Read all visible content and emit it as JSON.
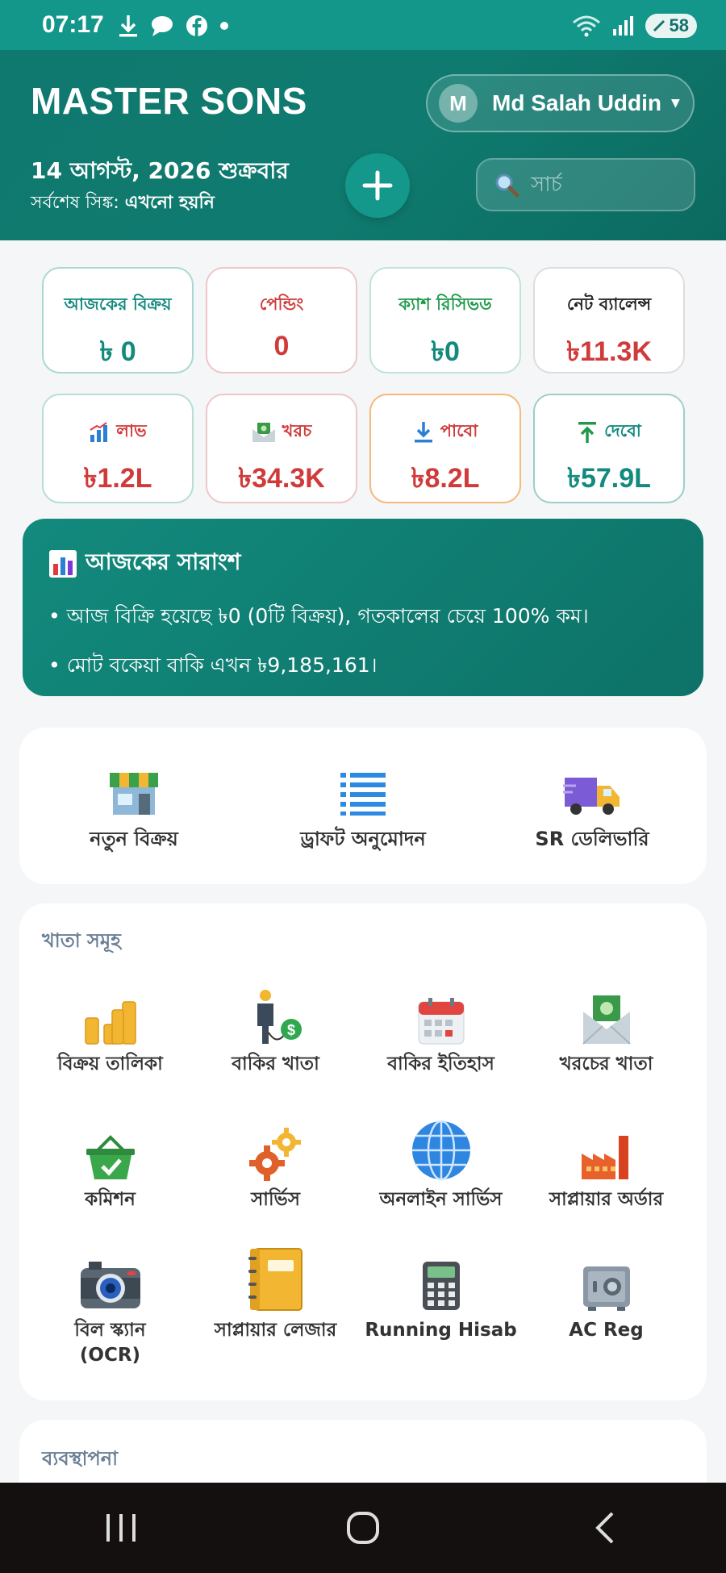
{
  "status_bar": {
    "time": "07:17",
    "battery": "58"
  },
  "header": {
    "brand": "MASTER SONS",
    "user_initial": "M",
    "user_name": "Md Salah Uddin",
    "date": "14 আগস্ট, 2026 শুক্রবার",
    "sync_label": "সর্বশেষ সিঙ্ক:",
    "sync_value": "এখনো হয়নি",
    "add_label": "+",
    "search_placeholder": "সার্চ"
  },
  "stats_row1": [
    {
      "label": "আজকের বিক্রয়",
      "value": "৳ 0",
      "label_color": "#128a7d",
      "value_color": "#128a7d",
      "border": "#a9d8d2"
    },
    {
      "label": "পেন্ডিং",
      "value": "0",
      "label_color": "#d13a3a",
      "value_color": "#d13a3a",
      "border": "#f0c6c6"
    },
    {
      "label": "ক্যাশ রিসিভড",
      "value": "৳0",
      "label_color": "#1f9a4a",
      "value_color": "#128a7d",
      "border": "#bfe4d6"
    },
    {
      "label": "নেট ব্যালেন্স",
      "value": "৳11.3K",
      "label_color": "#222222",
      "value_color": "#d13a3a",
      "border": "#dddddd"
    }
  ],
  "stats_row2": [
    {
      "label": "লাভ",
      "value": "৳1.2L",
      "label_color": "#d13a3a",
      "value_color": "#d13a3a",
      "border": "#b8dcd6",
      "icon": "bar-chart-icon"
    },
    {
      "label": "খরচ",
      "value": "৳34.3K",
      "label_color": "#d13a3a",
      "value_color": "#d13a3a",
      "border": "#f0c6c6",
      "icon": "money-envelope-icon"
    },
    {
      "label": "পাবো",
      "value": "৳8.2L",
      "label_color": "#d13a3a",
      "value_color": "#d13a3a",
      "border": "#f5b97a",
      "icon": "download-arrow-icon"
    },
    {
      "label": "দেবো",
      "value": "৳57.9L",
      "label_color": "#128a7d",
      "value_color": "#128a7d",
      "border": "#9ccfc7",
      "icon": "upload-arrow-icon"
    }
  ],
  "summary": {
    "title": "আজকের সারাংশ",
    "line1": "• আজ বিক্রি হয়েছে ৳0 (0টি বিক্রয়), গতকালের চেয়ে 100% কম।",
    "line2": "• মোট বকেয়া বাকি এখন ৳9,185,161।"
  },
  "quick_actions": [
    {
      "label": "নতুন বিক্রয়",
      "icon": "store-icon"
    },
    {
      "label": "ড্রাফট অনুমোদন",
      "icon": "list-icon"
    },
    {
      "label": "SR ডেলিভারি",
      "icon": "delivery-truck-icon"
    }
  ],
  "ledgers": {
    "title": "খাতা সমূহ",
    "items": [
      {
        "label": "বিক্রয় তালিকা",
        "icon": "coin-stacks-icon"
      },
      {
        "label": "বাকির খাতা",
        "icon": "person-dollar-icon"
      },
      {
        "label": "বাকির ইতিহাস",
        "icon": "calendar-icon"
      },
      {
        "label": "খরচের খাতা",
        "icon": "money-envelope-icon"
      },
      {
        "label": "কমিশন",
        "icon": "basket-check-icon"
      },
      {
        "label": "সার্ভিস",
        "icon": "gears-icon"
      },
      {
        "label": "অনলাইন সার্ভিস",
        "icon": "globe-icon"
      },
      {
        "label": "সাপ্লায়ার অর্ডার",
        "icon": "factory-icon"
      },
      {
        "label": "বিল স্ক্যান\n(OCR)",
        "icon": "camera-icon"
      },
      {
        "label": "সাপ্লায়ার লেজার",
        "icon": "notebook-icon"
      },
      {
        "label": "Running Hisab",
        "icon": "calculator-icon"
      },
      {
        "label": "AC Reg",
        "icon": "safe-icon"
      }
    ]
  },
  "management": {
    "title": "ব্যবস্থাপনা"
  }
}
